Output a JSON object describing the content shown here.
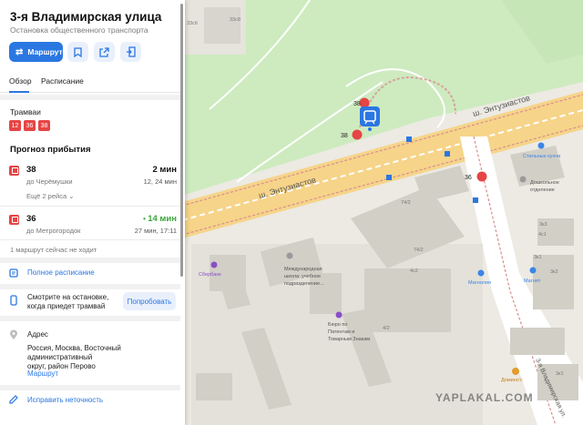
{
  "stop": {
    "title": "3-я Владимирская улица",
    "subtitle": "Остановка общественного транспорта"
  },
  "toolbar": {
    "route_label": "Маршрут"
  },
  "tabs": [
    {
      "label": "Обзор"
    },
    {
      "label": "Расписание"
    }
  ],
  "transport": {
    "label": "Трамваи",
    "badges": [
      "12",
      "36",
      "38"
    ]
  },
  "forecast": {
    "title": "Прогноз прибытия",
    "routes": [
      {
        "number": "38",
        "direction": "до Черёмушки",
        "time": "2 мин",
        "next": "12, 24 мин",
        "more": "Ещё 2 рейса"
      },
      {
        "number": "36",
        "direction": "до Метрогородок",
        "time": "14 мин",
        "next": "27 мин, 17:11"
      }
    ],
    "not_running": "1 маршрут сейчас не ходит"
  },
  "actions": {
    "full_schedule": "Полное расписание",
    "watch_line1": "Смотрите на остановке,",
    "watch_line2": "когда приедет трамвай",
    "try_label": "Попробовать"
  },
  "address": {
    "label": "Адрес",
    "line1": "Россия, Москва, Восточный административный",
    "line2": "округ, район Перово",
    "route_link": "Маршрут"
  },
  "fix": {
    "label": "Исправить неточность"
  },
  "map": {
    "street_main": "ш. Энтузиастов",
    "street_main_2": "ш. Энтузиастов",
    "street_side": "3-я Владимирская ул.",
    "pins": [
      {
        "label": "38"
      },
      {
        "label": "38"
      },
      {
        "label": "36"
      }
    ],
    "buildings": {
      "b1": "33с6",
      "b2": "33с8",
      "b3": "74/2",
      "b4": "74/2",
      "b5": "4с2",
      "b6": "4/2",
      "b7": "4с1",
      "b8": "3к1",
      "b9": "3к2",
      "b10": "3к3",
      "b11": "3к1"
    },
    "pois": {
      "store1": "Стильные кухни",
      "prefect": "Дошкольное",
      "prefect2": "отделение",
      "sber": "Сбербанк",
      "school1": "Международная",
      "school2": "школа: учебное",
      "school3": "подразделение...",
      "bureau1": "Бюро по",
      "bureau2": "Патентам и",
      "bureau3": "Товарным Знакам",
      "magnolia": "Магнолия",
      "magnit": "Магнит",
      "pizza": "Домино'с"
    },
    "watermark": "YAPLAKAL.COM"
  },
  "colors": {
    "accent": "#2b77e2",
    "tram": "#e64545",
    "green": "#3aa63a"
  }
}
